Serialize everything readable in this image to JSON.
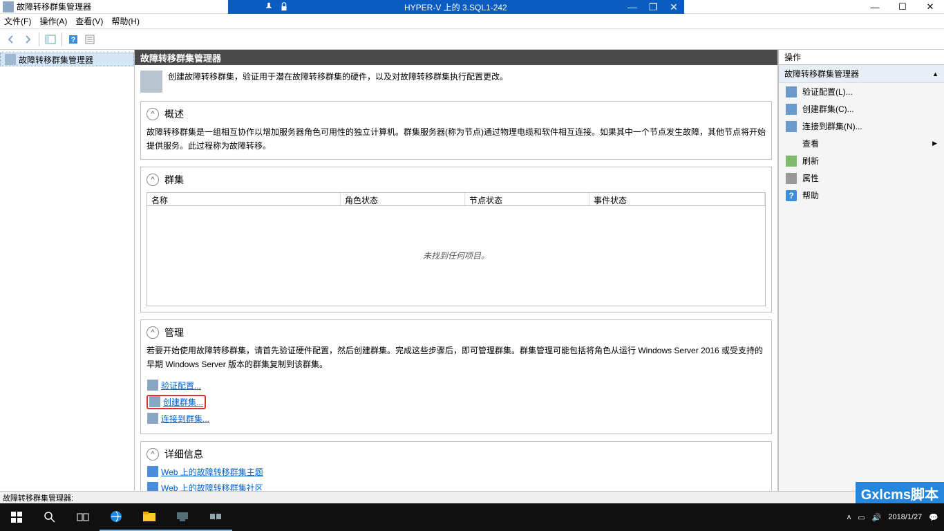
{
  "window": {
    "app_title": "故障转移群集管理器",
    "vm_title": "HYPER-V 上的 3.SQL1-242"
  },
  "menu": {
    "file": "文件(F)",
    "action": "操作(A)",
    "view": "查看(V)",
    "help": "帮助(H)"
  },
  "tree": {
    "root": "故障转移群集管理器"
  },
  "center": {
    "title": "故障转移群集管理器",
    "intro": "创建故障转移群集，验证用于潜在故障转移群集的硬件，以及对故障转移群集执行配置更改。",
    "overview": {
      "title": "概述",
      "body": "故障转移群集是一组相互协作以增加服务器角色可用性的独立计算机。群集服务器(称为节点)通过物理电缆和软件相互连接。如果其中一个节点发生故障，其他节点将开始提供服务。此过程称为故障转移。"
    },
    "clusters": {
      "title": "群集",
      "col_name": "名称",
      "col_role": "角色状态",
      "col_node": "节点状态",
      "col_event": "事件状态",
      "empty": "未找到任何项目。"
    },
    "manage": {
      "title": "管理",
      "body": "若要开始使用故障转移群集，请首先验证硬件配置，然后创建群集。完成这些步骤后，即可管理群集。群集管理可能包括将角色从运行 Windows Server 2016 或受支持的早期 Windows Server 版本的群集复制到该群集。",
      "link_validate": "验证配置...",
      "link_create": "创建群集...",
      "link_connect": "连接到群集..."
    },
    "details": {
      "title": "详细信息",
      "link_topics": "Web 上的故障转移群集主题",
      "link_community": "Web 上的故障转移群集社区"
    }
  },
  "actions": {
    "header": "操作",
    "group": "故障转移群集管理器",
    "validate": "验证配置(L)...",
    "create": "创建群集(C)...",
    "connect": "连接到群集(N)...",
    "view": "查看",
    "refresh": "刷新",
    "properties": "属性",
    "help": "帮助"
  },
  "status": "故障转移群集管理器:",
  "taskbar": {
    "date": "2018/1/27"
  },
  "watermark": "Gxlcms脚本"
}
